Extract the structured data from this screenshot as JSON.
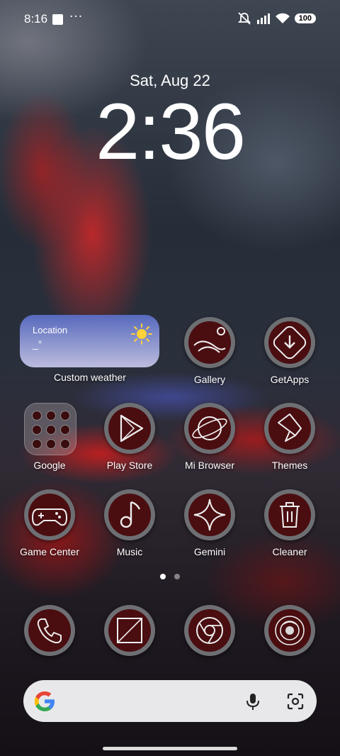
{
  "status_bar": {
    "time": "8:16",
    "more": "···",
    "battery": "100"
  },
  "lockscreen": {
    "date": "Sat, Aug 22",
    "clock": "2:36"
  },
  "weather_widget": {
    "location": "Location",
    "temperature": "_°",
    "label": "Custom weather"
  },
  "apps": {
    "gallery": "Gallery",
    "getapps": "GetApps",
    "google": "Google",
    "play_store": "Play Store",
    "mi_browser": "Mi Browser",
    "themes": "Themes",
    "game_center": "Game Center",
    "music": "Music",
    "gemini": "Gemini",
    "cleaner": "Cleaner"
  },
  "dock": [
    "phone-icon",
    "messages-icon",
    "chrome-icon",
    "camera-icon"
  ],
  "page_indicator": {
    "pages": 2,
    "current": 1
  },
  "search": {
    "icons": [
      "google-logo",
      "microphone-icon",
      "lens-icon"
    ]
  }
}
